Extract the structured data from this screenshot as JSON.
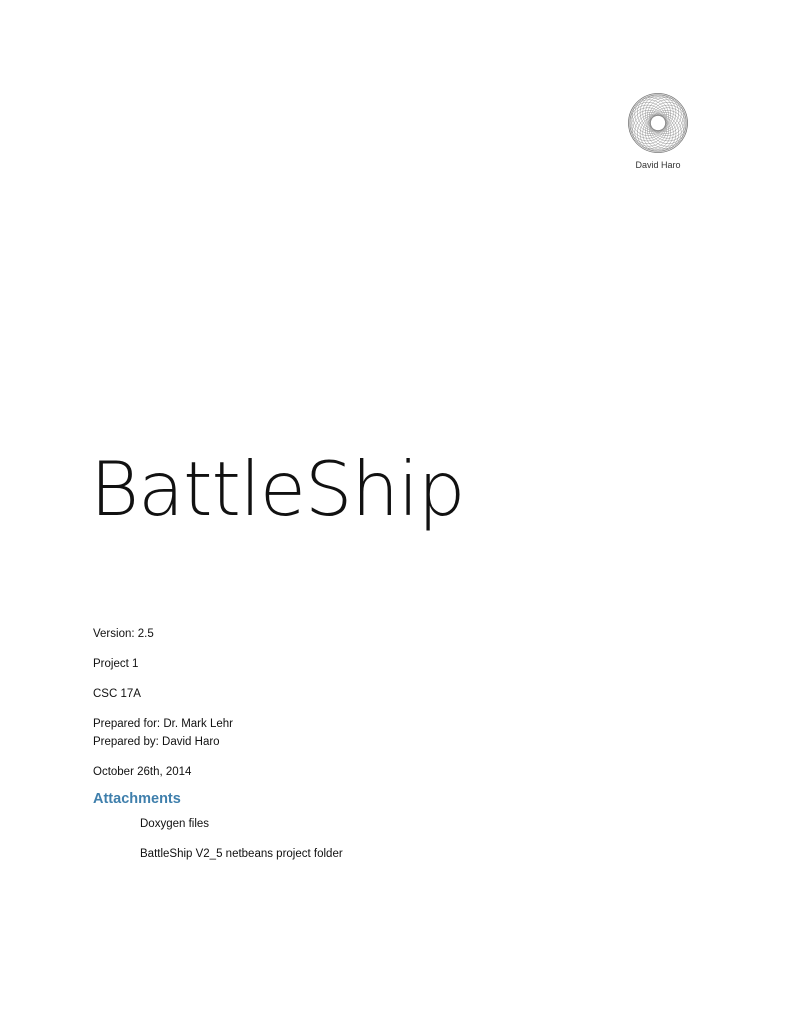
{
  "header": {
    "author_name": "David Haro",
    "logo_icon": "spirograph-logo-icon"
  },
  "title": "BattleShip",
  "meta": {
    "version": "Version: 2.5",
    "project": "Project 1",
    "course": "CSC 17A",
    "prepared_for": "Prepared for: Dr. Mark Lehr",
    "prepared_by": "Prepared by: David Haro",
    "date": "October 26th, 2014"
  },
  "attachments": {
    "heading": "Attachments",
    "heading_color": "#3f7fac",
    "items": [
      "Doxygen files",
      "BattleShip V2_5 netbeans project folder"
    ]
  }
}
